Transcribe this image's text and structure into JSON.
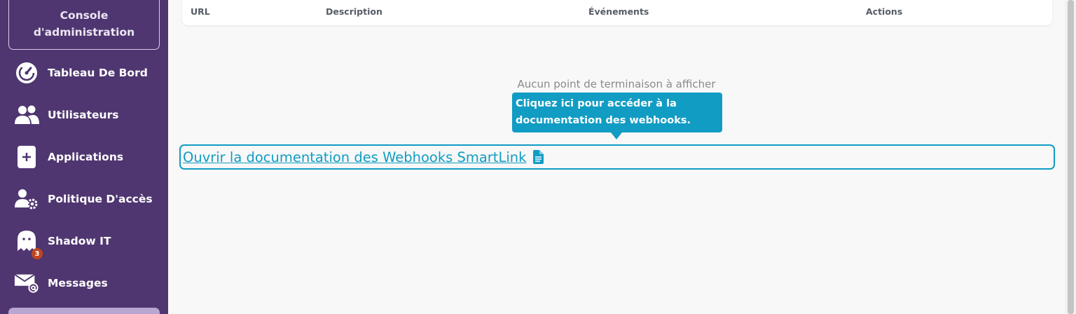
{
  "sidebar": {
    "console_label": "Console d'administration",
    "items": [
      {
        "label": "Tableau De Bord",
        "icon": "dashboard-icon"
      },
      {
        "label": "Utilisateurs",
        "icon": "users-icon"
      },
      {
        "label": "Applications",
        "icon": "add-app-icon"
      },
      {
        "label": "Politique D'accès",
        "icon": "user-gear-icon"
      },
      {
        "label": "Shadow IT",
        "icon": "ghost-icon",
        "badge": "3"
      },
      {
        "label": "Messages",
        "icon": "mail-at-icon"
      }
    ]
  },
  "table": {
    "columns": [
      "URL",
      "Description",
      "Événements",
      "Actions"
    ]
  },
  "main": {
    "empty_message": "Aucun point de terminaison à afficher",
    "tooltip": "Cliquez ici pour accéder à la documentation des webhooks.",
    "doc_link": "Ouvrir la documentation des Webhooks SmartLink"
  },
  "colors": {
    "sidebar_bg": "#4f3670",
    "accent": "#119cc4",
    "badge": "#c0451d"
  }
}
